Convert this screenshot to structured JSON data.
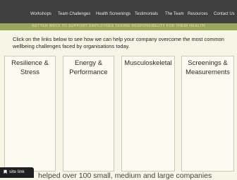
{
  "nav": {
    "items": [
      "Workshops",
      "Team Challenges",
      "Health Screenings",
      "Testimonials",
      "The Team",
      "Resources",
      "Contact Us"
    ]
  },
  "tagline": "BETTER WAYS TO SUPPORT EMPLOYEES TAKING RESPONSIBILITY FOR THEIR HEALTH",
  "intro": "Click on the links below to see how we can help your company overcome the most common wellbeing challenges faced by organisations today.",
  "boxes": [
    {
      "line1": "Resilience &",
      "line2": "Stress"
    },
    {
      "line1": "Energy &",
      "line2": "Performance"
    },
    {
      "line1": "Musculoskeletal",
      "line2": ""
    },
    {
      "line1": "Screenings &",
      "line2": "Measurements"
    }
  ],
  "bottom_text": "helped over 100 small, medium and large companies",
  "badge": {
    "label": "site link",
    "icon": "bookmark-icon"
  },
  "colors": {
    "nav_bg": "#3f3f3f",
    "tagline_bg": "#9aa75a",
    "page_bg": "#f7f6e6"
  }
}
